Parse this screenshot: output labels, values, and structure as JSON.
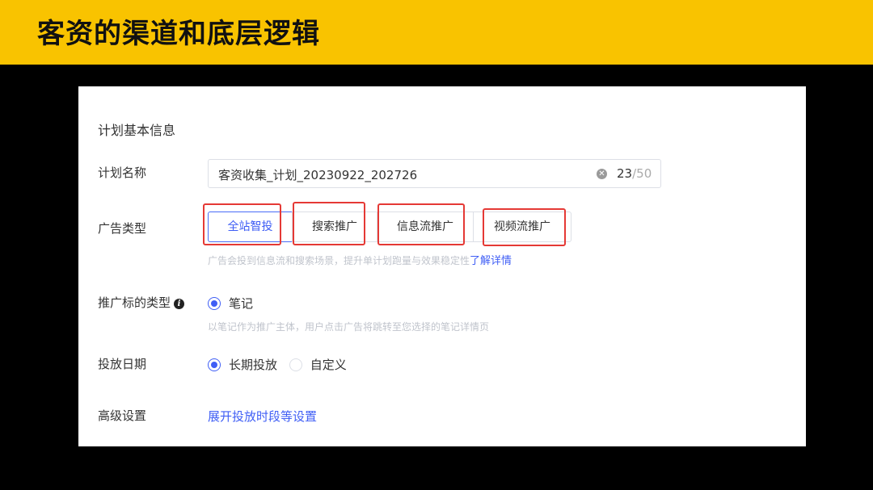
{
  "banner": {
    "title": "客资的渠道和底层逻辑"
  },
  "form": {
    "section_title": "计划基本信息",
    "plan_name": {
      "label": "计划名称",
      "value": "客资收集_计划_20230922_202726",
      "count_current": "23",
      "count_max": "/50"
    },
    "ad_type": {
      "label": "广告类型",
      "options": [
        "全站智投",
        "搜索推广",
        "信息流推广",
        "视频流推广"
      ],
      "selected": "全站智投",
      "hint": "广告会投到信息流和搜索场景，提升单计划跑量与效果稳定性",
      "hint_link": "了解详情"
    },
    "promo_target": {
      "label": "推广标的类型",
      "option": "笔记",
      "hint": "以笔记作为推广主体，用户点击广告将跳转至您选择的笔记详情页"
    },
    "schedule": {
      "label": "投放日期",
      "options": [
        "长期投放",
        "自定义"
      ],
      "selected": "长期投放"
    },
    "advanced": {
      "label": "高级设置",
      "link": "展开投放时段等设置"
    }
  },
  "colors": {
    "banner": "#f9c300",
    "accent": "#3f5ef5",
    "highlight": "#e53935"
  }
}
